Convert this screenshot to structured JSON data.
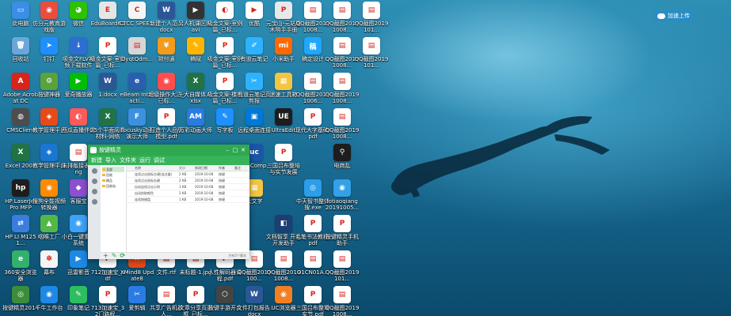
{
  "desktop": {
    "icons": [
      {
        "label": "此电脑",
        "color": "#3a8ee6",
        "glyph": "▭",
        "icon": "computer-icon"
      },
      {
        "label": "仿分元教育游戏版",
        "color": "#e84d3d",
        "glyph": "◉",
        "icon": "app-icon"
      },
      {
        "label": "微信",
        "color": "#2dc100",
        "glyph": "◕",
        "icon": "wechat-icon"
      },
      {
        "label": "EduBoard61",
        "color": "#e6e6e6",
        "glyph": "E",
        "icon": "file-icon"
      },
      {
        "label": "CTCC SPEE...",
        "color": "#f5f5f5",
        "glyph": "C",
        "icon": "file-icon"
      },
      {
        "label": "新建个人范...docx",
        "color": "#2b5797",
        "glyph": "W",
        "icon": "word-icon"
      },
      {
        "label": "另人机课区照.avi",
        "color": "#333333",
        "glyph": "▶",
        "icon": "video-icon"
      },
      {
        "label": "吸金文案-室例篇_已标...",
        "color": "#ffffff",
        "glyph": "◐",
        "icon": "chrome-icon"
      },
      {
        "label": "优酷",
        "color": "#ffffff",
        "glyph": "▶",
        "icon": "youku-icon"
      },
      {
        "label": "元宝山-元站魔木明手手册",
        "color": "#e8e8e8",
        "glyph": "P",
        "icon": "pdf-icon"
      },
      {
        "label": "QQ截图20191008...",
        "color": "#ffffff",
        "glyph": "▤",
        "icon": "image-icon"
      },
      {
        "label": "QQ截图20191008...",
        "color": "#ffffff",
        "glyph": "▤",
        "icon": "image-icon"
      },
      {
        "label": "QQ截图2019101...",
        "color": "#ffffff",
        "glyph": "▤",
        "icon": "image-icon"
      },
      {
        "label": "回收站",
        "color": "#6aa6d9",
        "glyph": "🗑",
        "icon": "recycle-bin-icon"
      },
      {
        "label": "钉钉",
        "color": "#1f8fff",
        "glyph": "➤",
        "icon": "dingtalk-icon"
      },
      {
        "label": "吸金文FLV视频下载软件",
        "color": "#2c6fd1",
        "glyph": "↓",
        "icon": "app-icon"
      },
      {
        "label": "吸金文案-室例篇_已标...",
        "color": "#ffffff",
        "glyph": "P",
        "icon": "pdf-icon"
      },
      {
        "label": "DyqtQdm...",
        "color": "#d6d6d6",
        "glyph": "▤",
        "icon": "image-icon"
      },
      {
        "label": "财付通",
        "color": "#f29b1d",
        "glyph": "¥",
        "icon": "app-icon"
      },
      {
        "label": "稿赋",
        "color": "#ffb400",
        "glyph": "✎",
        "icon": "app-icon"
      },
      {
        "label": "吸金文案-室例篇_已标...",
        "color": "#ffffff",
        "glyph": "P",
        "icon": "pdf-icon"
      },
      {
        "label": "有道云笔记",
        "color": "#2db2ff",
        "glyph": "✐",
        "icon": "notes-icon"
      },
      {
        "label": "小米助手",
        "color": "#ff6900",
        "glyph": "mi",
        "icon": "app-icon"
      },
      {
        "label": "稿定设计",
        "color": "#1ea7fd",
        "glyph": "稿",
        "icon": "app-icon"
      },
      {
        "label": "QQ截图20191008...",
        "color": "#ffffff",
        "glyph": "▤",
        "icon": "image-icon"
      },
      {
        "label": "QQ截图2019101...",
        "color": "#ffffff",
        "glyph": "▤",
        "icon": "image-icon"
      },
      {
        "label": "Adobe Acrobat DC",
        "color": "#d7251c",
        "glyph": "A",
        "icon": "acrobat-icon"
      },
      {
        "label": "按键神器",
        "color": "#5aa33c",
        "glyph": "⚙",
        "icon": "app-icon"
      },
      {
        "label": "爱奇播放器",
        "color": "#00be06",
        "glyph": "▶",
        "icon": "player-icon"
      },
      {
        "label": "1.docx",
        "color": "#2b5797",
        "glyph": "W",
        "icon": "word-icon"
      },
      {
        "label": "eBeam Interacti...",
        "color": "#2a5fb0",
        "glyph": "e",
        "icon": "app-icon"
      },
      {
        "label": "超级操作大法_已标...",
        "color": "#ff4d4d",
        "glyph": "◉",
        "icon": "app-icon"
      },
      {
        "label": "十大自媒体人.xlsx",
        "color": "#217346",
        "glyph": "X",
        "icon": "excel-icon"
      },
      {
        "label": "吸金文案-楼板篇_已标...",
        "color": "#ffffff",
        "glyph": "P",
        "icon": "pdf-icon"
      },
      {
        "label": "有道云笔记页剪报",
        "color": "#2db2ff",
        "glyph": "✂",
        "icon": "app-icon"
      },
      {
        "label": "迷速工具箱",
        "color": "#f4c542",
        "glyph": "▦",
        "icon": "toolbox-icon"
      },
      {
        "label": "QQ截图20191006...",
        "color": "#ffffff",
        "glyph": "▤",
        "icon": "image-icon"
      },
      {
        "label": "QQ截图20191008...",
        "color": "#ffffff",
        "glyph": "▤",
        "icon": "image-icon"
      },
      {
        "label": "CMSClient",
        "color": "#4d4d4d",
        "glyph": "◍",
        "icon": "camera-icon"
      },
      {
        "label": "教学管理平台",
        "color": "#e64a19",
        "glyph": "◈",
        "icon": "app-icon"
      },
      {
        "label": "西瓜直播伴侣",
        "color": "#ff5a5a",
        "glyph": "◐",
        "icon": "app-icon"
      },
      {
        "label": "35个平面阅奏材料-网络",
        "color": "#217346",
        "glyph": "X",
        "icon": "excel-icon"
      },
      {
        "label": "Focusky动画演示大师",
        "color": "#3d8fe0",
        "glyph": "F",
        "icon": "app-icon"
      },
      {
        "label": "打造个人品牌模型.pdf",
        "color": "#ffffff",
        "glyph": "P",
        "icon": "pdf-icon"
      },
      {
        "label": "万彩动画大师",
        "color": "#2a7ae2",
        "glyph": "AM",
        "icon": "app-icon"
      },
      {
        "label": "写字板",
        "color": "#1e90ff",
        "glyph": "✎",
        "icon": "wordpad-icon"
      },
      {
        "label": "远程桌面连接",
        "color": "#0078d7",
        "glyph": "▣",
        "icon": "rdp-icon"
      },
      {
        "label": "UltraEdit",
        "color": "#1d1d1d",
        "glyph": "UE",
        "icon": "app-icon"
      },
      {
        "label": "现代大字基础.pdf",
        "color": "#ffffff",
        "glyph": "P",
        "icon": "pdf-icon"
      },
      {
        "label": "QQ截图20191008...",
        "color": "#ffffff",
        "glyph": "▤",
        "icon": "image-icon"
      },
      {
        "label": "Excel 2007",
        "color": "#217346",
        "glyph": "X",
        "icon": "excel-icon"
      },
      {
        "label": "教学管理平台",
        "color": "#1976d2",
        "glyph": "◈",
        "icon": "app-icon"
      },
      {
        "label": "未排版接表.png",
        "color": "#ffffff",
        "glyph": "▤",
        "icon": "image-icon"
      },
      {
        "label": "UltraComp...",
        "color": "#1a56a8",
        "glyph": "uc",
        "icon": "app-icon"
      },
      {
        "label": "三国吕布整培与实节发展",
        "color": "#ffffff",
        "glyph": "P",
        "icon": "pdf-icon"
      },
      {
        "label": "电商乱",
        "color": "#1d1d1d",
        "glyph": "⚲",
        "icon": "app-icon"
      },
      {
        "label": "HP LaserJet Pro MFP",
        "color": "#1d1d1d",
        "glyph": "hp",
        "icon": "printer-icon"
      },
      {
        "label": "搜狗全能视频转换器",
        "color": "#ff8a00",
        "glyph": "◉",
        "icon": "app-icon"
      },
      {
        "label": "客服宝",
        "color": "#8c4fcf",
        "glyph": "◆",
        "icon": "app-icon"
      },
      {
        "label": "大文字",
        "color": "#f4c542",
        "glyph": "▦",
        "icon": "app-icon"
      },
      {
        "label": "中天智书整体搜.exe",
        "color": "#2b9de9",
        "glyph": "◎",
        "icon": "app-icon"
      },
      {
        "label": "fotiaoqiang 20191005...",
        "color": "#34a0e8",
        "glyph": "◉",
        "icon": "app-icon"
      },
      {
        "label": "HP LI M1251...",
        "color": "#3b7ddd",
        "glyph": "⇄",
        "icon": "app-icon"
      },
      {
        "label": "咽喉工厂",
        "color": "#54b848",
        "glyph": "▲",
        "icon": "app-icon"
      },
      {
        "label": "小白一键重装系统",
        "color": "#3fa2f7",
        "glyph": "◉",
        "icon": "app-icon"
      },
      {
        "label": "文档智享 开台开发助手",
        "color": "#1d3e73",
        "glyph": "◧",
        "icon": "app-icon"
      },
      {
        "label": "毛笔书法教程.pdf",
        "color": "#ffffff",
        "glyph": "P",
        "icon": "pdf-icon"
      },
      {
        "label": "按键精灵手机助手",
        "color": "#ffffff",
        "glyph": "P",
        "icon": "pdf-icon"
      },
      {
        "label": "360安全浏览器",
        "color": "#32b16c",
        "glyph": "e",
        "icon": "browser-icon"
      },
      {
        "label": "幕布",
        "color": "#f5f5f5",
        "glyph": "✽",
        "icon": "app-icon"
      },
      {
        "label": "迅雷影音",
        "color": "#1e88e5",
        "glyph": "▶",
        "icon": "player-icon"
      },
      {
        "label": "712加速宝_pdf",
        "color": "#ffffff",
        "glyph": "P",
        "icon": "pdf-icon"
      },
      {
        "label": "XMind8 Update8",
        "color": "#e64a19",
        "glyph": "✕",
        "icon": "xmind-icon"
      },
      {
        "label": "文件.rtf",
        "color": "#ffffff",
        "glyph": "▤",
        "icon": "file-icon"
      },
      {
        "label": "未标题-1.jpg",
        "color": "#ffffff",
        "glyph": "▤",
        "icon": "image-icon"
      },
      {
        "label": "人性解码器课程.pdf",
        "color": "#ffffff",
        "glyph": "P",
        "icon": "pdf-icon"
      },
      {
        "label": "QQ截图2019100...",
        "color": "#ffffff",
        "glyph": "▤",
        "icon": "image-icon"
      },
      {
        "label": "QQ截图20191008...",
        "color": "#ffffff",
        "glyph": "▤",
        "icon": "image-icon"
      },
      {
        "label": "O1CN01A...",
        "color": "#ffffff",
        "glyph": "▤",
        "icon": "image-icon"
      },
      {
        "label": "QQ截图2019101...",
        "color": "#ffffff",
        "glyph": "▤",
        "icon": "image-icon"
      },
      {
        "label": "按键精灵2014",
        "color": "#3b8d3b",
        "glyph": "◎",
        "icon": "app-icon"
      },
      {
        "label": "千牛工作台",
        "color": "#1e88e5",
        "glyph": "◉",
        "icon": "app-icon"
      },
      {
        "label": "印象笔记",
        "color": "#2dbe60",
        "glyph": "✎",
        "icon": "evernote-icon"
      },
      {
        "label": "713加速宝_32门路程...",
        "color": "#ffffff",
        "glyph": "P",
        "icon": "pdf-icon"
      },
      {
        "label": "爱剪辑",
        "color": "#2a7be4",
        "glyph": "✂",
        "icon": "app-icon"
      },
      {
        "label": "共享广告机器人...",
        "color": "#ffffff",
        "glyph": "▤",
        "icon": "file-icon"
      },
      {
        "label": "文章分享页面框_已标...",
        "color": "#ffffff",
        "glyph": "P",
        "icon": "pdf-icon"
      },
      {
        "label": "按键手游开台",
        "color": "#444444",
        "glyph": "⬡",
        "icon": "app-icon"
      },
      {
        "label": "文件打包报告.docx",
        "color": "#2b5797",
        "glyph": "W",
        "icon": "word-icon"
      },
      {
        "label": "UC浏览器",
        "color": "#f47e22",
        "glyph": "◉",
        "icon": "browser-icon"
      },
      {
        "label": "三国吕布整理实节.pdf",
        "color": "#ffffff",
        "glyph": "P",
        "icon": "pdf-icon"
      },
      {
        "label": "QQ截图20191008...",
        "color": "#ffffff",
        "glyph": "▤",
        "icon": "image-icon"
      }
    ],
    "cloud_button": "加速上传"
  },
  "window": {
    "title": "按键精灵",
    "toolbar": [
      "新建",
      "导入",
      "文件夹",
      "运行",
      "调试"
    ],
    "tree": [
      "全部",
      "回收",
      "精品",
      "回收站"
    ],
    "columns": [
      "",
      "名称",
      "大小",
      "修改日期",
      "作者",
      "备注"
    ],
    "rows": [
      [
        "",
        "连续点击鼠标左键(连点器)",
        "2 KB",
        "2019-10-08",
        "按键",
        ""
      ],
      [
        "",
        "连续点击鼠标右键",
        "2 KB",
        "2019-10-08",
        "按键",
        ""
      ],
      [
        "",
        "自动连续点击示例",
        "1 KB",
        "2019-10-08",
        "按键",
        ""
      ],
      [
        "",
        "自动拾取颜色",
        "2 KB",
        "2019-10-08",
        "按键",
        ""
      ],
      [
        "",
        "连续按键盘",
        "1 KB",
        "2019-10-08",
        "按键",
        ""
      ]
    ],
    "status": "共有5个脚本"
  }
}
